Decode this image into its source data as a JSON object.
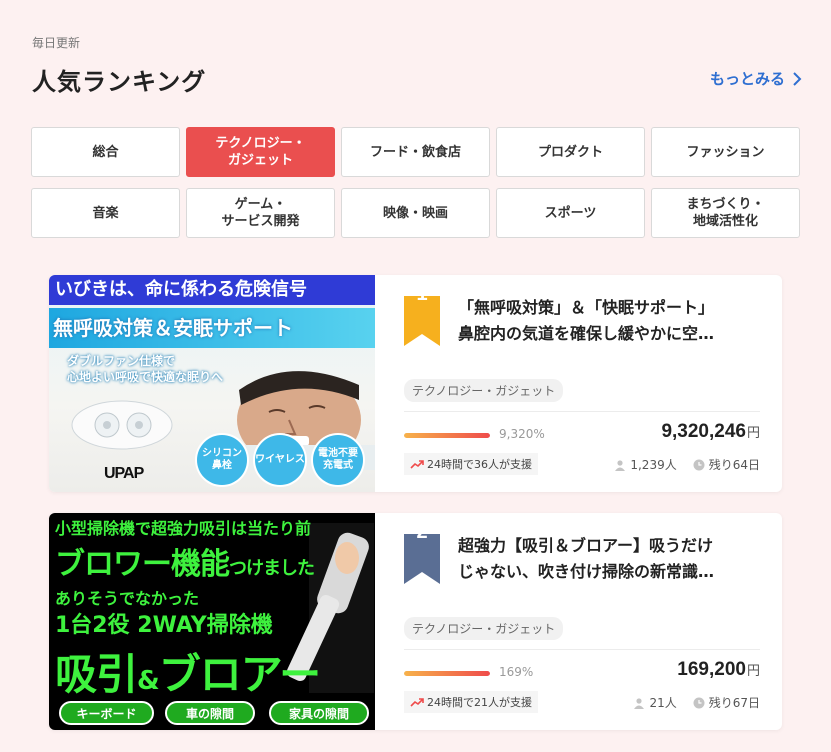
{
  "header": {
    "daily_label": "毎日更新",
    "title": "人気ランキング",
    "more_label": "もっとみる"
  },
  "categories": [
    {
      "label": "総合",
      "active": false
    },
    {
      "label": "テクノロジー・\nガジェット",
      "active": true
    },
    {
      "label": "フード・飲食店",
      "active": false
    },
    {
      "label": "プロダクト",
      "active": false
    },
    {
      "label": "ファッション",
      "active": false
    },
    {
      "label": "音楽",
      "active": false
    },
    {
      "label": "ゲーム・\nサービス開発",
      "active": false
    },
    {
      "label": "映像・映画",
      "active": false
    },
    {
      "label": "スポーツ",
      "active": false
    },
    {
      "label": "まちづくり・\n地域活性化",
      "active": false
    }
  ],
  "colors": {
    "accent": "#ea4f4f",
    "link": "#2f6fd1",
    "rank1_ribbon": "#f6b01e",
    "rank2_ribbon": "#5a6e94"
  },
  "projects": [
    {
      "rank": "1",
      "title": "「無呼吸対策」＆「快眠サポート」\n鼻腔内の気道を確保し緩やかに空…",
      "tag": "テクノロジー・ガジェット",
      "percent": "9,320%",
      "progress": 1.0,
      "amount": "9,320,246",
      "yen": "円",
      "support_text": "24時間で36人が支援",
      "backers": "1,239人",
      "remaining": "残り64日",
      "thumb": {
        "top": "いびきは、命に係わる危険信号",
        "band": "無呼吸対策＆安眠サポート",
        "sub": "ダブルファン仕様で\n心地よい呼吸で快適な眠りへ",
        "bubbles": [
          "シリコン\n鼻栓",
          "ワイヤレス",
          "電池不要\n充電式"
        ],
        "logo": "UPAP"
      }
    },
    {
      "rank": "2",
      "title": "超強力【吸引＆ブロアー】吸うだけ\nじゃない、吹き付け掃除の新常識…",
      "tag": "テクノロジー・ガジェット",
      "percent": "169%",
      "progress": 1.0,
      "amount": "169,200",
      "yen": "円",
      "support_text": "24時間で21人が支援",
      "backers": "21人",
      "remaining": "残り67日",
      "thumb": {
        "l1": "小型掃除機で超強力吸引は当たり前",
        "l2a": "ブロワー機能",
        "l2b": "つけました",
        "l3": "ありそうでなかった",
        "l4": "1台2役 2WAY掃除機",
        "l5a": "吸引",
        "l5b": "&",
        "l5c": "ブロアー",
        "pills": [
          "キーボード",
          "車の隙間",
          "家具の隙間"
        ]
      }
    }
  ]
}
